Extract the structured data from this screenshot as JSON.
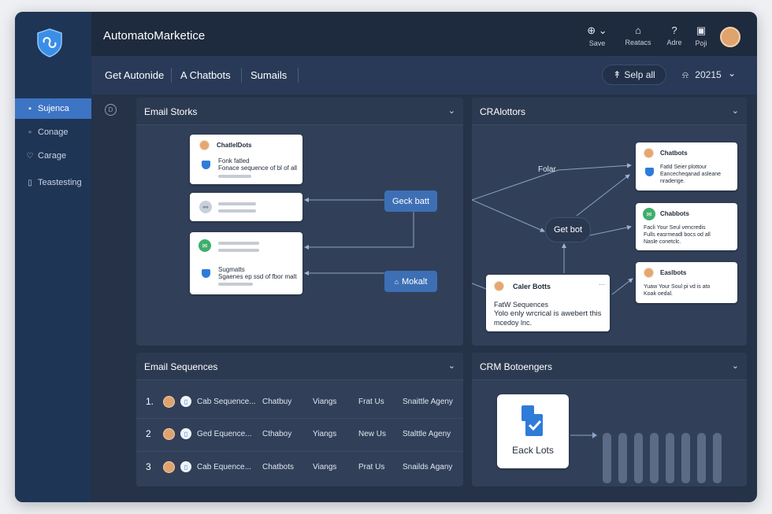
{
  "app": {
    "title": "AutomatoMarketice"
  },
  "header": {
    "actions": [
      {
        "icon": "globe-icon",
        "glyph": "⊕ ⌄",
        "label": "Save"
      },
      {
        "icon": "tag-icon",
        "glyph": "⌂",
        "label": "Reatacs"
      },
      {
        "icon": "help-icon",
        "glyph": "?",
        "label": "Adre"
      },
      {
        "icon": "clipboard-icon",
        "glyph": "▣",
        "label": "Poji"
      }
    ]
  },
  "subbar": {
    "tabs": [
      "Get Autonide",
      "A Chatbots",
      "Sumails"
    ],
    "select_all": "Selp all",
    "select_all_icon": "↟",
    "year_icon": "⍾",
    "year": "20215"
  },
  "sidebar": {
    "items": [
      {
        "label": "Sujenca",
        "icon": "lock-icon",
        "glyph": "🔒"
      },
      {
        "label": "Conage",
        "icon": "inbox-icon",
        "glyph": "⎕"
      },
      {
        "label": "Carage",
        "icon": "heart-icon",
        "glyph": "♡"
      },
      {
        "label": "Teastesting",
        "icon": "book-icon",
        "glyph": "▯"
      }
    ]
  },
  "panels": {
    "email_storks": {
      "title": "Email Storks",
      "card1": {
        "title": "ChatlelDots",
        "line1": "Fonk fatled",
        "line2": "Fonace sequence of bl of all"
      },
      "card3": {
        "line1": "Sugmatts",
        "line2": "Sgaenes ep ssd of fbor malt"
      },
      "node_gate": "Geck batt",
      "node_market": "Mokalt"
    },
    "cr": {
      "title": "CRAlottors",
      "edge_label": "Folar",
      "node_get": "Get bot",
      "card1": {
        "title": "Chatbots",
        "line1": "Fatld Seier plottour",
        "line2": "Eancecheqanad asleane",
        "line3": "nraderige."
      },
      "card2": {
        "title": "Chabbots",
        "line1": "Facli  Your Seul vencredis",
        "line2": "Fulls   easrmeadl bocs od all",
        "line3": "Nasle conetclc."
      },
      "card3": {
        "title": "Easlbots",
        "line1": "Yuaw  Your Soul pi vd is ato",
        "line2": "Koak oedal."
      },
      "caller": {
        "title": "Caler Botts",
        "line1": "FatW Sequences",
        "line2": "Yolo enly wrcrical is awebert this",
        "line3": "mcedoy lnc."
      }
    },
    "email_sequences": {
      "title": "Email Sequences",
      "rows": [
        {
          "num": "1.",
          "name": "Cab Sequence...",
          "col2": "Chatbuy",
          "col3": "Viangs",
          "col4": "Frat Us",
          "col5": "Snaittle Ageny"
        },
        {
          "num": "2",
          "name": "Ged Equence...",
          "col2": "Cthaboy",
          "col3": "Yiangs",
          "col4": "New Us",
          "col5": "Stalttle Ageny"
        },
        {
          "num": "3",
          "name": "Cab Equence...",
          "col2": "Chatbots",
          "col3": "Viangs",
          "col4": "Prat Us",
          "col5": "Snailds Agany"
        }
      ]
    },
    "crm": {
      "title": "CRM Botoengers",
      "tile_label": "Eack Lots",
      "bar_count": 8
    }
  },
  "colors": {
    "accent": "#3d74c4",
    "node": "#3d6fb5",
    "panel": "#314058",
    "success": "#3fae6d"
  }
}
